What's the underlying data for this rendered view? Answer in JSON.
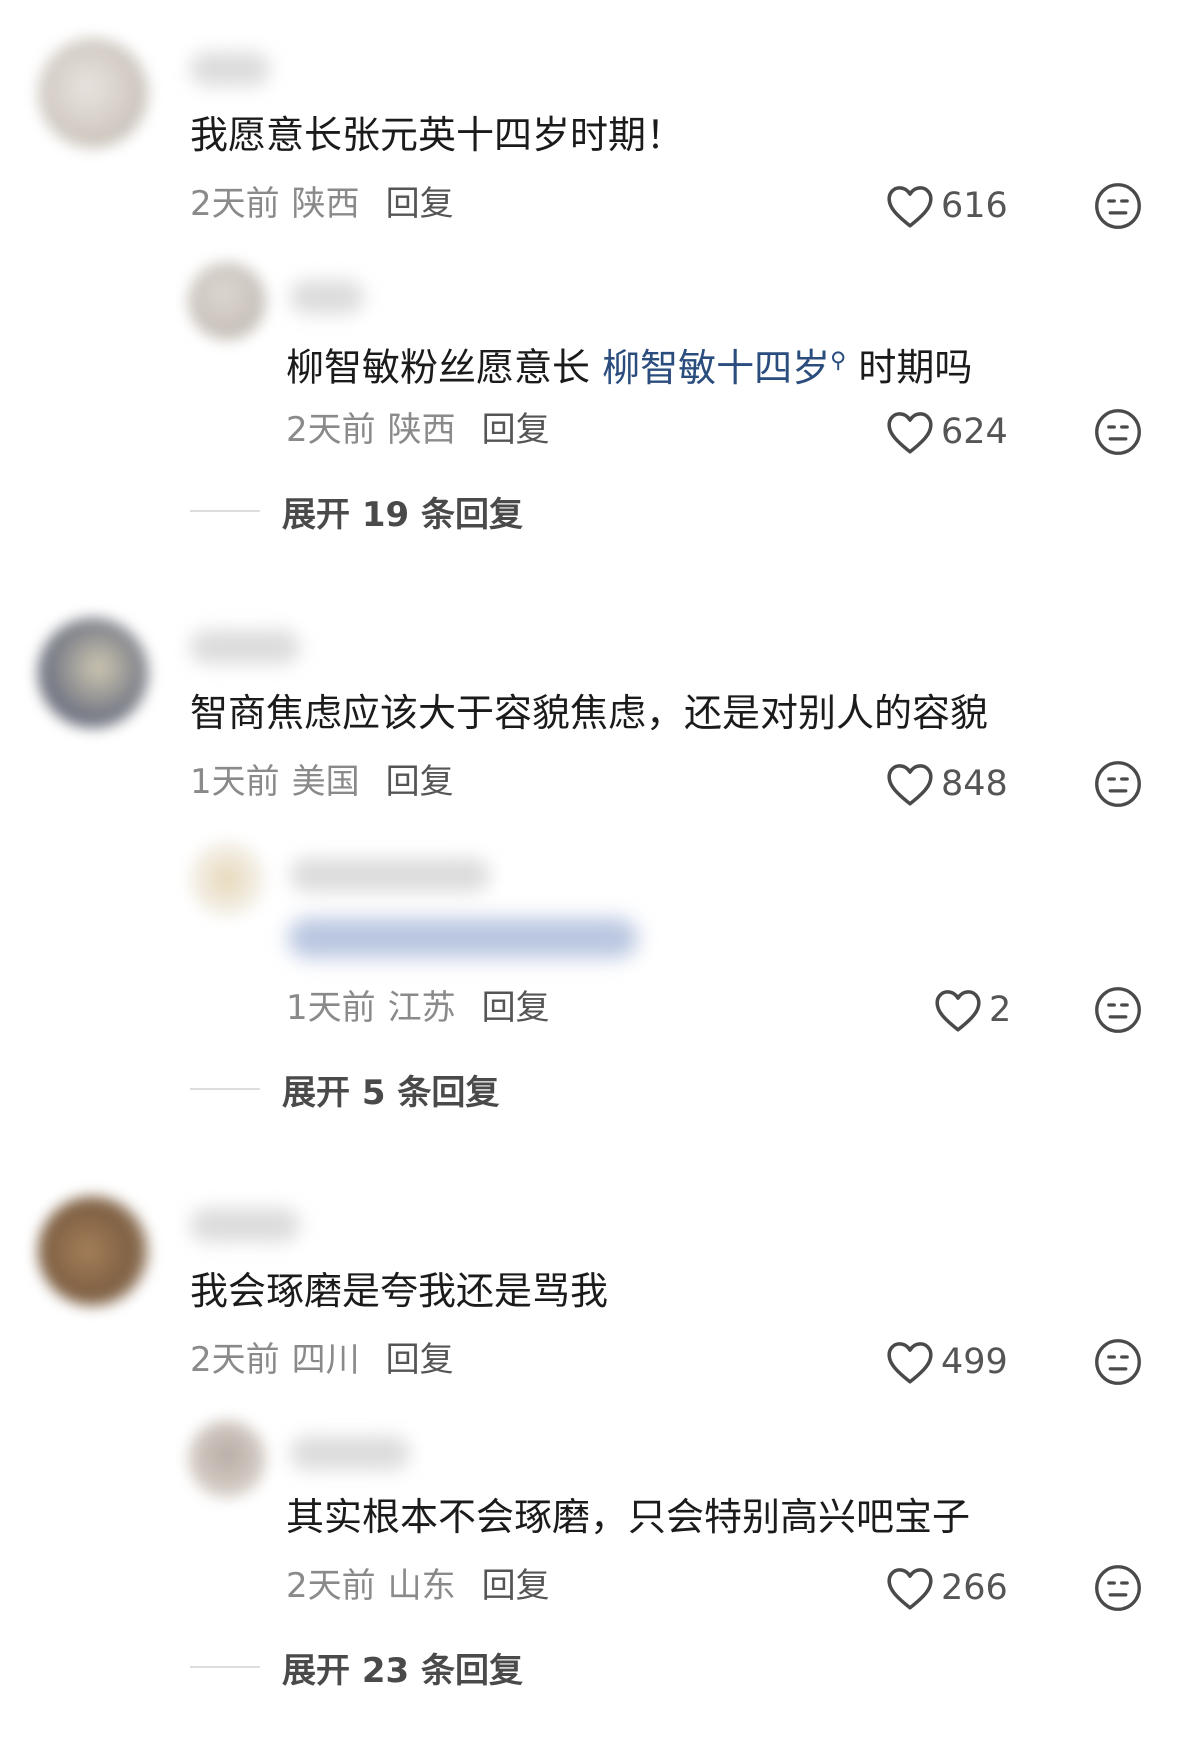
{
  "comments": [
    {
      "text": "我愿意长张元英十四岁时期！",
      "time": "2天前",
      "location": "陕西",
      "reply_label": "回复",
      "likes": "616",
      "replies": [
        {
          "text_before": "柳智敏粉丝愿意长 ",
          "mention": "柳智敏十四岁",
          "text_after": " 时期吗",
          "time": "2天前",
          "location": "陕西",
          "reply_label": "回复",
          "likes": "624"
        }
      ],
      "expand_label": "展开 19 条回复"
    },
    {
      "text": "智商焦虑应该大于容貌焦虑，还是对别人的容貌",
      "time": "1天前",
      "location": "美国",
      "reply_label": "回复",
      "likes": "848",
      "replies": [
        {
          "time": "1天前",
          "location": "江苏",
          "reply_label": "回复",
          "likes": "2"
        }
      ],
      "expand_label": "展开 5 条回复"
    },
    {
      "text": "我会琢磨是夸我还是骂我",
      "time": "2天前",
      "location": "四川",
      "reply_label": "回复",
      "likes": "499",
      "replies": [
        {
          "text": "其实根本不会琢磨，只会特别高兴吧宝子",
          "time": "2天前",
          "location": "山东",
          "reply_label": "回复",
          "likes": "266"
        }
      ],
      "expand_label": "展开 23 条回复"
    }
  ],
  "icons": {
    "like": "heart-outline-icon",
    "dislike": "meh-face-icon",
    "search": "search-icon"
  },
  "colors": {
    "mention": "#2b4d7e",
    "meta": "#8a8a8a",
    "text": "#1b1b1b"
  }
}
